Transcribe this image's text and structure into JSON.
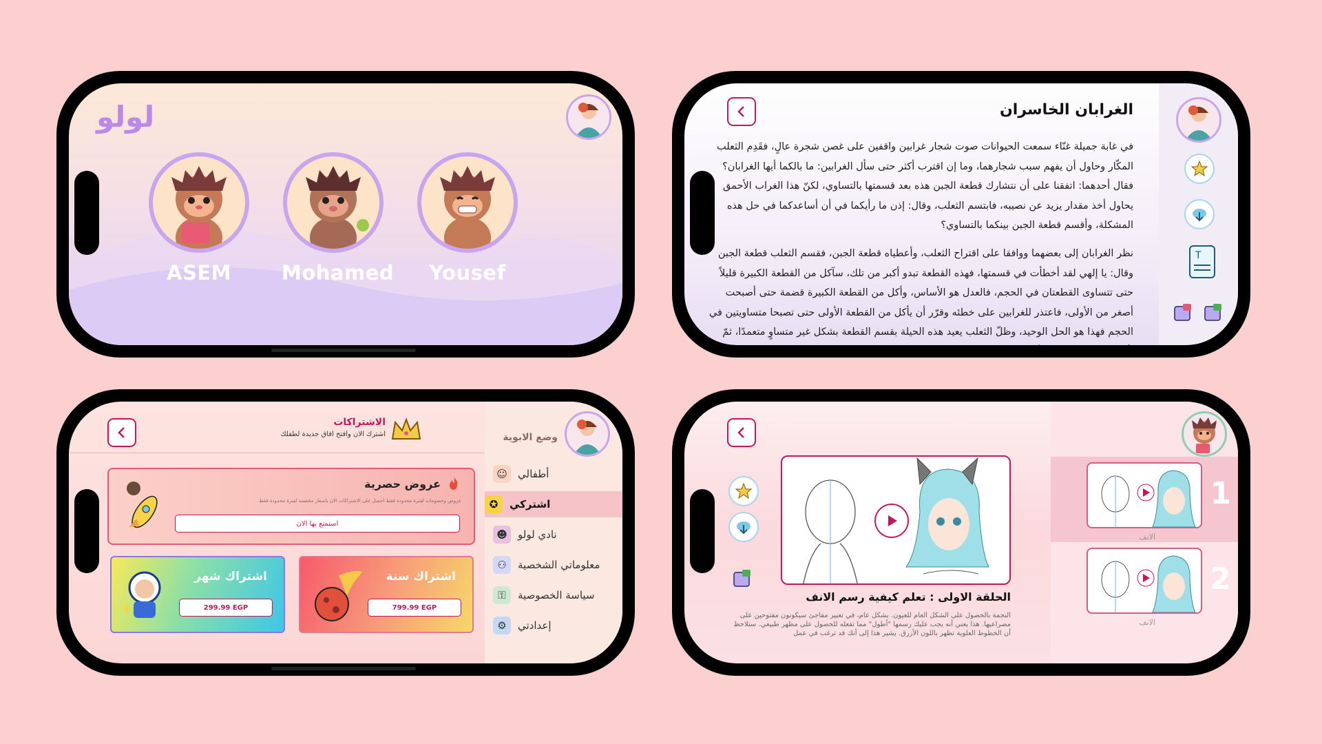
{
  "phone1": {
    "app_title": "لولو",
    "kids": [
      {
        "name": "ASEM"
      },
      {
        "name": "Mohamed"
      },
      {
        "name": "Yousef"
      }
    ]
  },
  "phone2": {
    "title": "الغرابان الخاسران",
    "paragraphs": [
      "في غابة جميلة غنّاء سمعت الحيوانات صوت شجار غرابين واقفين على غصن شجرة عالٍ، فقَدِم الثعلب المكّار وحاول أن يفهم سبب شجارهما، وما إن اقترب أكثر حتى سأل الغرابين: ما بالكما أيها الغرابان؟ فقال أحدهما: اتفقنا على أن نتشارك قطعة الجبن هذه بعد قسمتها بالتساوي، لكنّ هذا الغراب الأحمق يحاول أخذ مقدار يزيد عن نصيبه، فابتسم الثعلب، وقال: إذن ما رأيكما في أن أساعدكما في حل هذه المشكلة، وأقسم قطعة الجبن بينكما بالتساوي؟",
      "نظر الغرابان إلى بعضهما ووافقا على اقتراح الثعلب، وأعطياه قطعة الجبن، فقسم الثعلب قطعة الجبن وقال: يا إلهي لقد أخطأت في قسمتها، فهذه القطعة تبدو أكبر من تلك، سآكل من القطعة الكبيرة قليلاً حتى تتساوى القطعتان في الحجم، فالعدل هو الأساس، وأكل من القطعة الكبيرة قضمة حتى أصبحت أصغر من الأولى، فاعتذر للغرابين على خطئه وقرّر أن يأكل من القطعة الأولى حتى تصبحا متساويتين في الحجم فهذا هو الحل الوحيد، وظلّ الثعلب يعيد هذه الحيلة بقسم القطعة بشكل غير متساوٍ متعمدًا، ثمّ يأكل من قطعة فتصبح أصغر"
    ]
  },
  "phone3": {
    "header_title": "الاشتراكات",
    "header_subtitle": "اشترك الان وافتح افاق جديدة لطفلك",
    "parent_mode": "وضع الابوية",
    "offer_title": "عروض حصرية",
    "offer_desc": "عروض وخصومات لفترة محدودة فقط احصل على الاشتراكات الان باسعار مخفضة لفترة محدودة فقط",
    "offer_button": "استمتع بها الان",
    "monthly_title": "اشتراك شهر",
    "monthly_price": "299.99 EGP",
    "yearly_title": "اشتراك سنة",
    "yearly_price": "799.99 EGP",
    "menu": [
      {
        "label": "أطفالي",
        "icon": "kids-icon"
      },
      {
        "label": "اشتركي",
        "icon": "subscribe-icon",
        "active": true
      },
      {
        "label": "نادي لولو",
        "icon": "club-icon"
      },
      {
        "label": "معلوماتي الشخصية",
        "icon": "profile-icon"
      },
      {
        "label": "سياسة الخصوصية",
        "icon": "privacy-icon"
      },
      {
        "label": "إعدادتي",
        "icon": "settings-icon"
      }
    ]
  },
  "phone4": {
    "episode_title": "الحلقة الاولى : تعلم كيفية رسم الانف",
    "episode_desc": "النجمة بالحصول على الشكل العام للعيون. بشكل عام، في تعبير مفاجئ سيكونون مفتوحين على مصراعيها. هذا يعني أنه يجب عليك رسمها \"أطول\" مما تفعله للحصول على مظهر طبيعي. ستلاحظ أن الخطوط العلوية تظهر باللون الأزرق. يشير هذا إلى أنك قد ترغب في عمل",
    "episodes": [
      {
        "num": "1",
        "label": "الانف"
      },
      {
        "num": "2",
        "label": "الانف"
      }
    ]
  },
  "colors": {
    "background": "#fdd0d0",
    "accent": "#c2185b",
    "lavender": "#c8a6ee"
  }
}
